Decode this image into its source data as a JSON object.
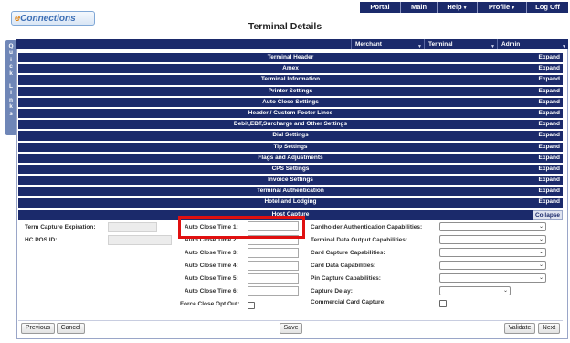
{
  "topnav": {
    "items": [
      {
        "label": "Portal"
      },
      {
        "label": "Main"
      },
      {
        "label": "Help"
      },
      {
        "label": "Profile"
      },
      {
        "label": "Log Off"
      }
    ]
  },
  "logo": {
    "text_e": "e",
    "text_rest": "Connections"
  },
  "page_title": "Terminal Details",
  "quick_links": [
    "Q",
    "u",
    "i",
    "c",
    "k",
    "",
    "L",
    "i",
    "n",
    "k",
    "s"
  ],
  "header_dropdowns": {
    "merchant": "Merchant",
    "terminal": "Terminal",
    "admin": "Admin"
  },
  "sections": [
    {
      "title": "Terminal Header",
      "action": "Expand"
    },
    {
      "title": "Amex",
      "action": "Expand"
    },
    {
      "title": "Terminal Information",
      "action": "Expand"
    },
    {
      "title": "Printer Settings",
      "action": "Expand"
    },
    {
      "title": "Auto Close Settings",
      "action": "Expand"
    },
    {
      "title": "Header / Custom Footer Lines",
      "action": "Expand"
    },
    {
      "title": "Debit,EBT,Surcharge and Other Settings",
      "action": "Expand"
    },
    {
      "title": "Dial Settings",
      "action": "Expand"
    },
    {
      "title": "Tip Settings",
      "action": "Expand"
    },
    {
      "title": "Flags and Adjustments",
      "action": "Expand"
    },
    {
      "title": "CPS Settings",
      "action": "Expand"
    },
    {
      "title": "Invoice Settings",
      "action": "Expand"
    },
    {
      "title": "Terminal Authentication",
      "action": "Expand"
    },
    {
      "title": "Hotel and Lodging",
      "action": "Expand"
    }
  ],
  "host_capture": {
    "title": "Host Capture",
    "action": "Collapse",
    "left": {
      "term_capture_expiration": "Term Capture Expiration:",
      "hc_pos_id": "HC POS ID:"
    },
    "middle": {
      "auto_close_1": "Auto Close Time 1:",
      "auto_close_2": "Auto Close Time 2:",
      "auto_close_3": "Auto Close Time 3:",
      "auto_close_4": "Auto Close Time 4:",
      "auto_close_5": "Auto Close Time 5:",
      "auto_close_6": "Auto Close Time 6:",
      "force_close_opt_out": "Force Close Opt Out:"
    },
    "right": {
      "cardholder_auth": "Cardholder Authentication Capabilities:",
      "terminal_data_output": "Terminal Data Output Capabilities:",
      "card_capture": "Card Capture Capabilities:",
      "card_data": "Card Data Capabilities:",
      "pin_capture": "Pin Capture Capabilities:",
      "capture_delay": "Capture Delay:",
      "commercial_card_capture": "Commercial Card Capture:"
    }
  },
  "buttons": {
    "previous": "Previous",
    "cancel": "Cancel",
    "save": "Save",
    "validate": "Validate",
    "next": "Next"
  },
  "colors": {
    "navy": "#1b2a6b",
    "highlight": "#e01010"
  }
}
